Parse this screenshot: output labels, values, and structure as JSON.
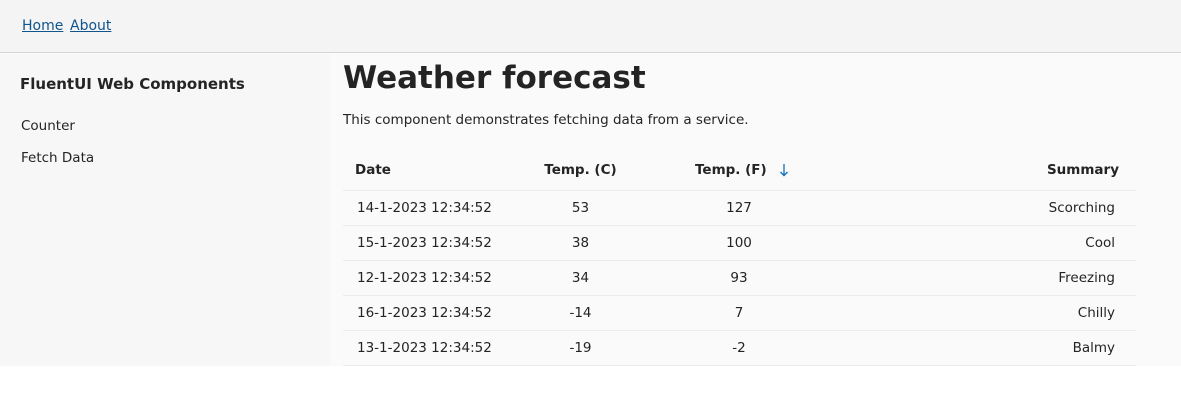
{
  "topbar": {
    "home_label": "Home",
    "about_label": "About"
  },
  "sidebar": {
    "brand": "FluentUI Web Components",
    "items": [
      {
        "label": "Counter"
      },
      {
        "label": "Fetch Data"
      }
    ]
  },
  "main": {
    "title": "Weather forecast",
    "intro": "This component demonstrates fetching data from a service."
  },
  "table": {
    "columns": [
      "Date",
      "Temp. (C)",
      "Temp. (F)",
      "Summary"
    ],
    "sort": {
      "column": "Temp. (F)",
      "direction": "descending",
      "icon": "arrow-down-icon"
    },
    "rows": [
      {
        "date": "14-1-2023 12:34:52",
        "temp_c": "53",
        "temp_f": "127",
        "summary": "Scorching"
      },
      {
        "date": "15-1-2023 12:34:52",
        "temp_c": "38",
        "temp_f": "100",
        "summary": "Cool"
      },
      {
        "date": "12-1-2023 12:34:52",
        "temp_c": "34",
        "temp_f": "93",
        "summary": "Freezing"
      },
      {
        "date": "16-1-2023 12:34:52",
        "temp_c": "-14",
        "temp_f": "7",
        "summary": "Chilly"
      },
      {
        "date": "13-1-2023 12:34:52",
        "temp_c": "-19",
        "temp_f": "-2",
        "summary": "Balmy"
      }
    ]
  },
  "colors": {
    "link": "#0f548c",
    "text": "#242424",
    "sort_icon": "#0f6cbd"
  }
}
